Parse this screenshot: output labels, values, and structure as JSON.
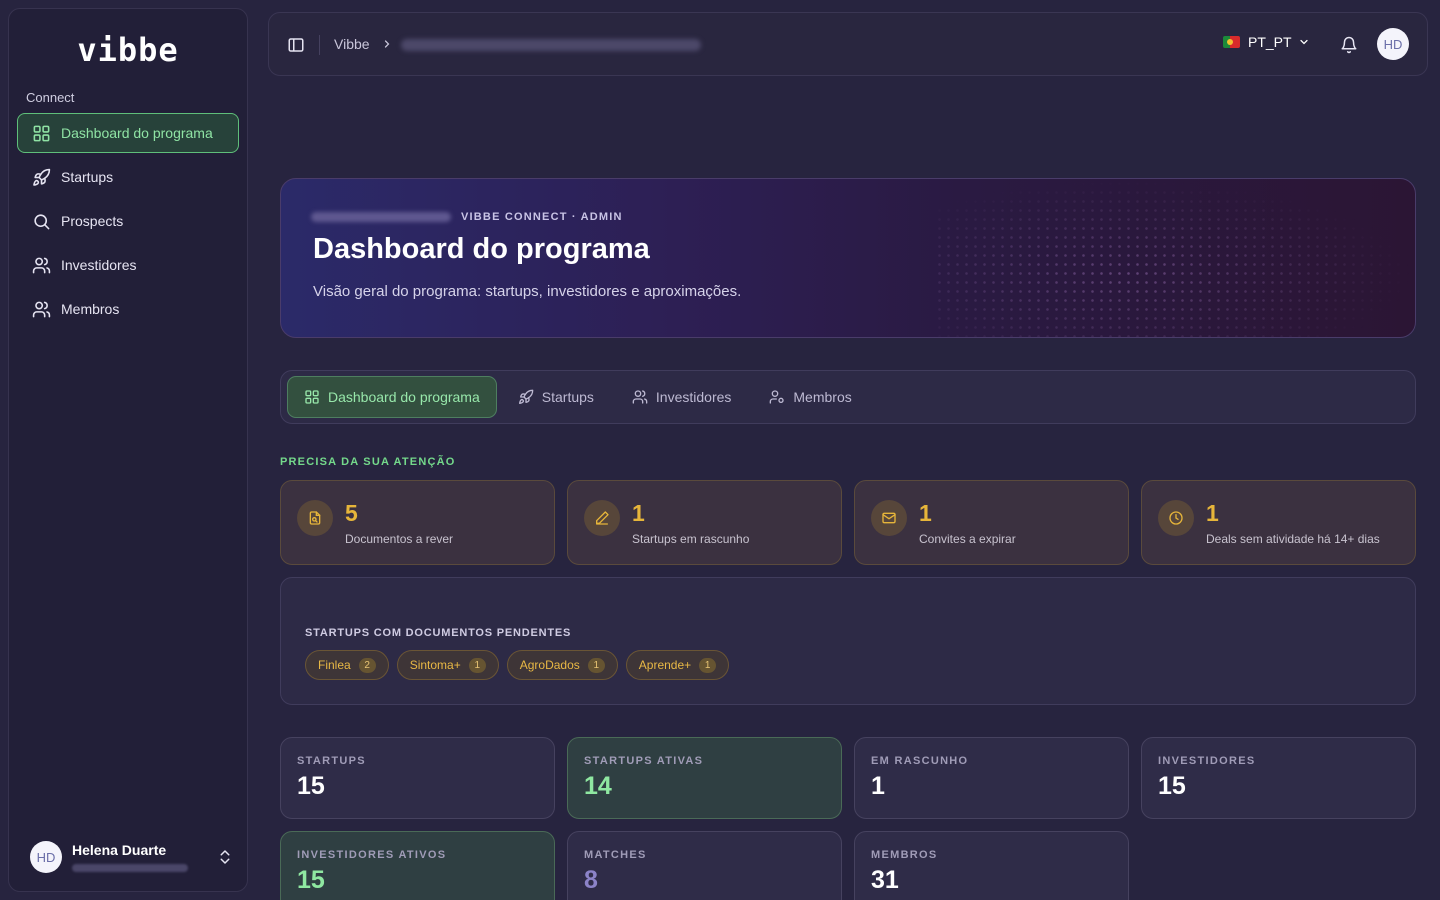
{
  "sidebar": {
    "logo": "vibbe",
    "section_label": "Connect",
    "items": [
      {
        "label": "Dashboard do programa",
        "icon": "grid-icon",
        "active": true
      },
      {
        "label": "Startups",
        "icon": "rocket-icon"
      },
      {
        "label": "Prospects",
        "icon": "search-icon"
      },
      {
        "label": "Investidores",
        "icon": "users-icon"
      },
      {
        "label": "Membros",
        "icon": "users-icon"
      }
    ],
    "user": {
      "initials": "HD",
      "name": "Helena Duarte"
    }
  },
  "topbar": {
    "breadcrumb_home": "Vibbe",
    "language": "PT_PT",
    "avatar_initials": "HD"
  },
  "hero": {
    "kicker": "VIBBE CONNECT · ADMIN",
    "title": "Dashboard do programa",
    "subtitle": "Visão geral do programa: startups, investidores e aproximações."
  },
  "tabs": [
    {
      "label": "Dashboard do programa",
      "icon": "grid-icon",
      "active": true
    },
    {
      "label": "Startups",
      "icon": "rocket-icon"
    },
    {
      "label": "Investidores",
      "icon": "users-icon"
    },
    {
      "label": "Membros",
      "icon": "user-cog-icon"
    }
  ],
  "attention": {
    "title": "PRECISA DA SUA ATENÇÃO",
    "cards": [
      {
        "value": "5",
        "label": "Documentos a rever",
        "icon": "file-icon"
      },
      {
        "value": "1",
        "label": "Startups em rascunho",
        "icon": "pencil-icon"
      },
      {
        "value": "1",
        "label": "Convites a expirar",
        "icon": "mail-icon"
      },
      {
        "value": "1",
        "label": "Deals sem atividade há 14+ dias",
        "icon": "clock-icon"
      }
    ]
  },
  "pending_docs": {
    "title": "STARTUPS COM DOCUMENTOS PENDENTES",
    "chips": [
      {
        "name": "Finlea",
        "count": "2"
      },
      {
        "name": "Sintoma+",
        "count": "1"
      },
      {
        "name": "AgroDados",
        "count": "1"
      },
      {
        "name": "Aprende+",
        "count": "1"
      }
    ]
  },
  "stats": [
    {
      "label": "STARTUPS",
      "value": "15",
      "variant": "default"
    },
    {
      "label": "STARTUPS ATIVAS",
      "value": "14",
      "variant": "green"
    },
    {
      "label": "EM RASCUNHO",
      "value": "1",
      "variant": "default"
    },
    {
      "label": "INVESTIDORES",
      "value": "15",
      "variant": "default"
    },
    {
      "label": "INVESTIDORES ATIVOS",
      "value": "15",
      "variant": "green"
    },
    {
      "label": "MATCHES",
      "value": "8",
      "variant": "muted"
    },
    {
      "label": "MEMBROS",
      "value": "31",
      "variant": "default"
    }
  ],
  "colors": {
    "accent_green": "#8fe3a4",
    "warning_amber": "#e6b53a",
    "background": "#27243f"
  }
}
